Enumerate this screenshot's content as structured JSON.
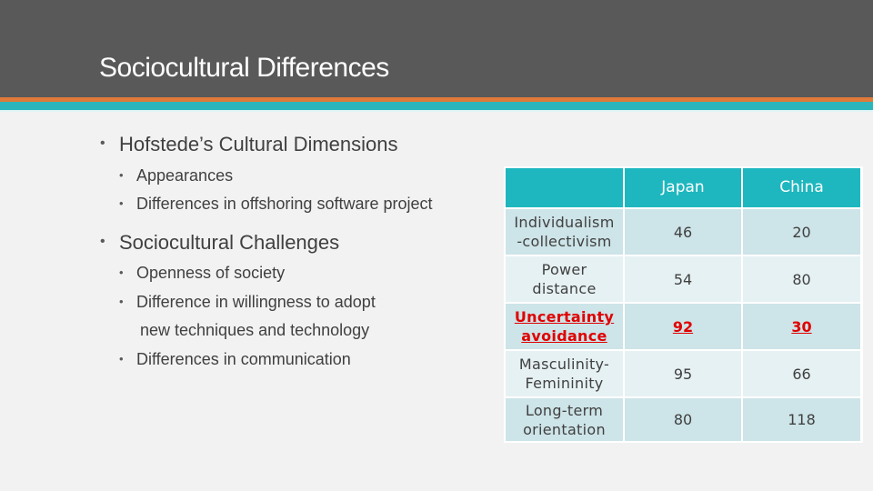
{
  "slide": {
    "title": "Sociocultural Differences",
    "colors": {
      "header_bg": "#595959",
      "accent_orange": "#e07b39",
      "accent_teal": "#2cb5bb",
      "table_header": "#1eb7bf",
      "highlight_red": "#e00000"
    }
  },
  "bullets": [
    {
      "text": "Hofstede’s Cultural Dimensions",
      "children": [
        "Appearances",
        "Differences in offshoring software project"
      ]
    },
    {
      "text": "Sociocultural Challenges",
      "children": [
        "Openness of society",
        "Difference in willingness to adopt new techniques and technology",
        "Differences in communication"
      ],
      "wrapped_line_1": "Difference in willingness to adopt",
      "wrapped_line_2": "new techniques and technology"
    }
  ],
  "table": {
    "columns": [
      "",
      "Japan",
      "China"
    ],
    "rows": [
      {
        "label_line1": "Individualism",
        "label_line2": "-collectivism",
        "japan": "46",
        "china": "20",
        "highlighted": false
      },
      {
        "label_line1": "Power",
        "label_line2": "distance",
        "japan": "54",
        "china": "80",
        "highlighted": false
      },
      {
        "label_line1": "Uncertainty",
        "label_line2": "avoidance",
        "japan": "92",
        "china": "30",
        "highlighted": true
      },
      {
        "label_line1": "Masculinity-",
        "label_line2": "Femininity",
        "japan": "95",
        "china": "66",
        "highlighted": false
      },
      {
        "label_line1": "Long-term",
        "label_line2": "orientation",
        "japan": "80",
        "china": "118",
        "highlighted": false
      }
    ]
  },
  "icons": {
    "bullet": "•"
  }
}
